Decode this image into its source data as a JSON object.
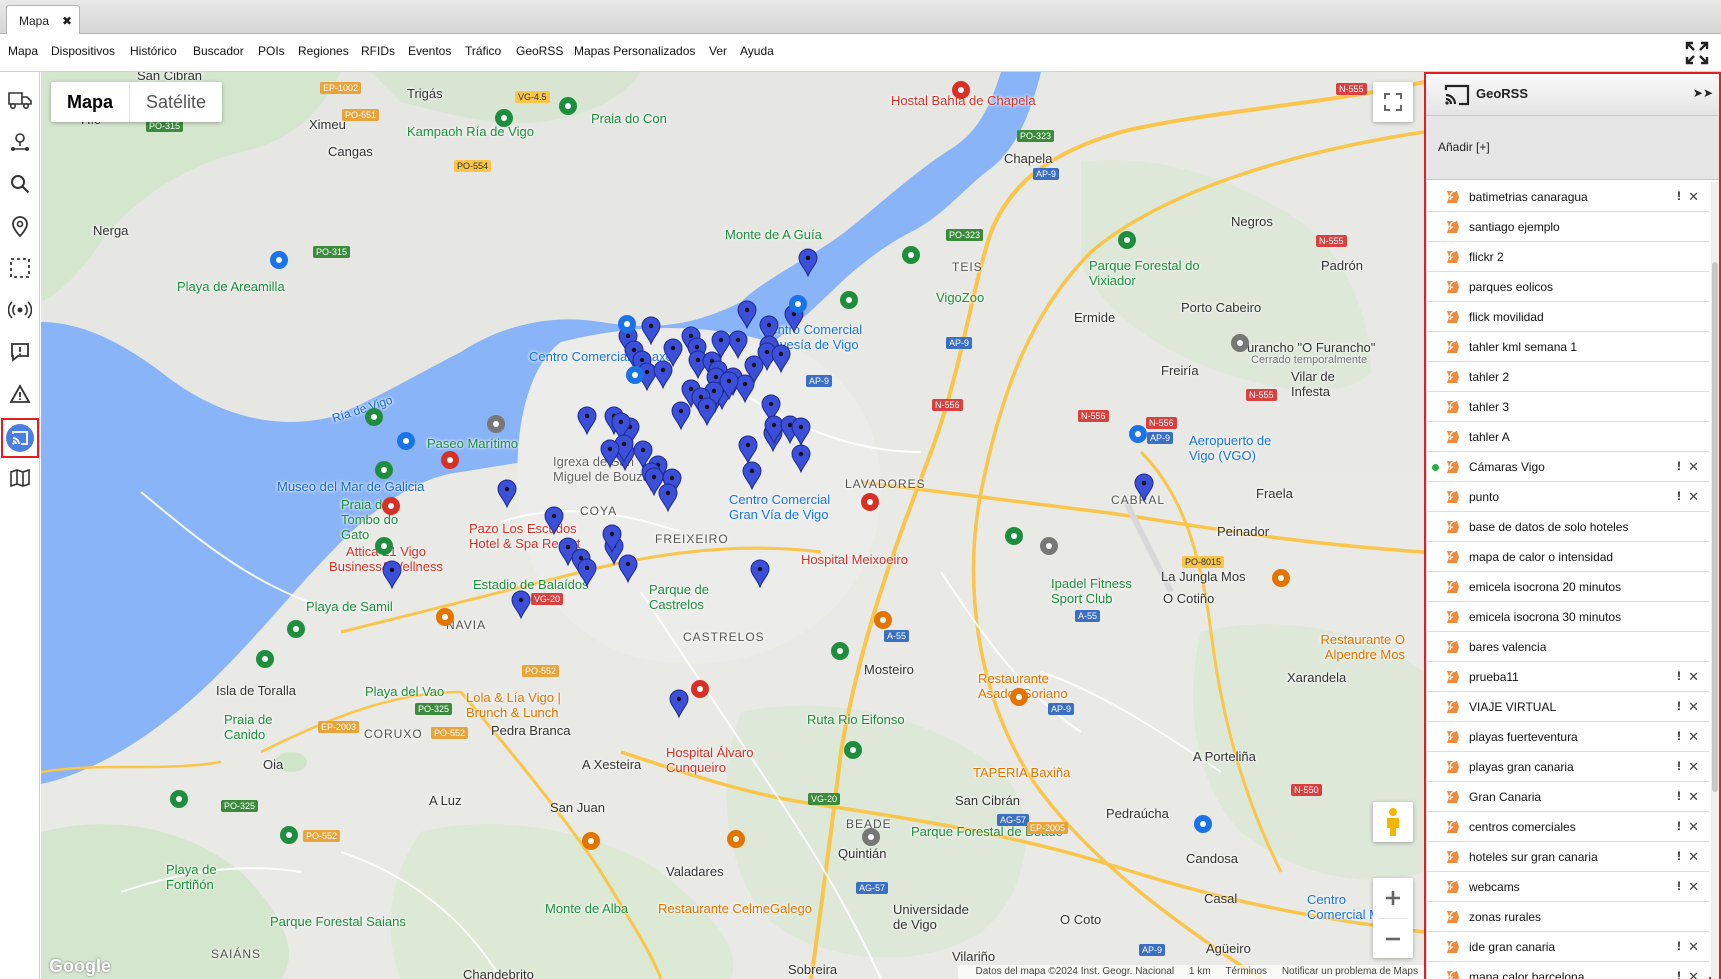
{
  "tabs": [
    {
      "label": "Mapa",
      "close": "✖"
    }
  ],
  "menu": [
    "Mapa",
    "Dispositivos",
    "Histórico",
    "Buscador",
    "POIs",
    "Regiones",
    "RFIDs",
    "Eventos",
    "Tráfico",
    "GeoRSS",
    "Mapas Personalizados",
    "Ver",
    "Ayuda"
  ],
  "left_tools": [
    "truck-icon",
    "route-icon",
    "search-icon",
    "location-pin-icon",
    "selection-icon",
    "broadcast-icon",
    "alert-message-icon",
    "warning-icon",
    "georss-cast-icon",
    "custom-map-icon"
  ],
  "map": {
    "type_buttons": {
      "map": "Mapa",
      "satellite": "Satélite"
    },
    "google_logo": "Google",
    "attribution": {
      "data": "Datos del mapa ©2024 Inst. Geogr. Nacional",
      "scale": "1 km",
      "terms": "Términos",
      "report": "Notificar un problema de Maps"
    },
    "places": [
      "San Cibrán",
      "Trigás",
      "Hío",
      "Ximeu",
      "Cangas",
      "Nerga",
      "Praia do Con",
      "Kampaoh Ría de Vigo",
      "Hostal Bahía de Chapela",
      "Chapela",
      "Monte de A Guía",
      "TEIS",
      "Parque Forestal do Vixiador",
      "VigoZoo",
      "Negros",
      "Padrón",
      "Playa de Areamilla",
      "Ermide",
      "Porto Cabeiro",
      "Centro Comercial Travesía de Vigo",
      "Centro Comercial A Laxe",
      "Furancho \"O Furancho\"",
      "Cerrado temporalmente",
      "Freiría",
      "Vilar de Infesta",
      "Ría de Vigo",
      "Paseo Marítimo",
      "Igrexa de San Miguel de Bouzas",
      "LAVADORES",
      "Aeropuerto de Vigo (VGO)",
      "Museo del Mar de Galicia",
      "Praia do Tombo do Gato",
      "Pazo Los Escudos Hotel & Spa Resort",
      "COYA",
      "Centro Comercial Gran Vía de Vigo",
      "CABRAL",
      "Fraela",
      "Peinador",
      "Attica 21 Vigo Business&Wellness",
      "FREIXEIRO",
      "Hospital Meixoeiro",
      "Ipadel Fitness Sport Club",
      "La Jungla Mos",
      "O Cotiño",
      "Playa de Samil",
      "Estadio de Balaídos",
      "Parque de Castrelos",
      "NAVIA",
      "CASTRELOS",
      "Restaurante O Alpendre Mos",
      "Xarandela",
      "Isla de Toralla",
      "Playa del Vao",
      "Mosteiro",
      "Restaurante Asador Soriano",
      "Praia de Canido",
      "CORUXO",
      "Lola & Lía Vigo | Brunch & Lunch",
      "Ruta Rio Eifonso",
      "Pedra Branca",
      "Oia",
      "A Xesteira",
      "Hospital Álvaro Cunqueiro",
      "TAPERIA Baxiña",
      "A Porteliña",
      "A Luz",
      "San Juan",
      "BEADE",
      "San Cibrán",
      "Pedraúcha",
      "Parque Forestal de Beade",
      "Quintián",
      "Candosa",
      "Playa de Fortiñón",
      "Valadares",
      "Casal",
      "Parque Forestal Saians",
      "Monte de Alba",
      "Restaurante CelmeGalego",
      "Universidade de Vigo",
      "O Coto",
      "Centro Comercial Merlin",
      "SAIÁNS",
      "Vilariño",
      "Agüeiro",
      "Sobreira",
      "Chandebrito"
    ]
  },
  "panel": {
    "title": "GeoRSS",
    "collapse": "➤➤",
    "add_label": "Añadir  [+]",
    "items": [
      {
        "name": "batimetrias canaragua",
        "active": false,
        "warn": true
      },
      {
        "name": "santiago ejemplo",
        "active": false,
        "warn": false
      },
      {
        "name": "flickr 2",
        "active": false,
        "warn": false
      },
      {
        "name": "parques eolicos",
        "active": false,
        "warn": false
      },
      {
        "name": "flick movilidad",
        "active": false,
        "warn": false
      },
      {
        "name": "tahler kml semana 1",
        "active": false,
        "warn": false
      },
      {
        "name": "tahler 2",
        "active": false,
        "warn": false
      },
      {
        "name": "tahler 3",
        "active": false,
        "warn": false
      },
      {
        "name": "tahler A",
        "active": false,
        "warn": false
      },
      {
        "name": "Cámaras Vigo",
        "active": true,
        "warn": true
      },
      {
        "name": "punto",
        "active": false,
        "warn": true
      },
      {
        "name": "base de datos de solo hoteles",
        "active": false,
        "warn": false
      },
      {
        "name": "mapa de calor o intensidad",
        "active": false,
        "warn": false
      },
      {
        "name": "emicela isocrona  20 minutos",
        "active": false,
        "warn": false
      },
      {
        "name": "emicela isocrona 30 minutos",
        "active": false,
        "warn": false
      },
      {
        "name": "bares valencia",
        "active": false,
        "warn": false
      },
      {
        "name": "prueba11",
        "active": false,
        "warn": true
      },
      {
        "name": "VIAJE VIRTUAL",
        "active": false,
        "warn": true
      },
      {
        "name": "playas fuerteventura",
        "active": false,
        "warn": true
      },
      {
        "name": "playas gran canaria",
        "active": false,
        "warn": true
      },
      {
        "name": "Gran Canaria",
        "active": false,
        "warn": true
      },
      {
        "name": "centros comerciales",
        "active": false,
        "warn": true
      },
      {
        "name": "hoteles sur gran canaria",
        "active": false,
        "warn": true
      },
      {
        "name": "webcams",
        "active": false,
        "warn": true
      },
      {
        "name": "zonas rurales",
        "active": false,
        "warn": false
      },
      {
        "name": "ide gran canaria",
        "active": false,
        "warn": true
      },
      {
        "name": "mapa calor barcelona",
        "active": false,
        "warn": true
      }
    ],
    "warn_glyph": "!",
    "delete_glyph": "✕"
  },
  "colors": {
    "accent_red": "#e02020",
    "marker_blue": "#3b4fd8",
    "water": "#8ab4f8",
    "land": "#e8e8e4",
    "park": "#c8e6c9",
    "highway": "#f9c54a"
  }
}
